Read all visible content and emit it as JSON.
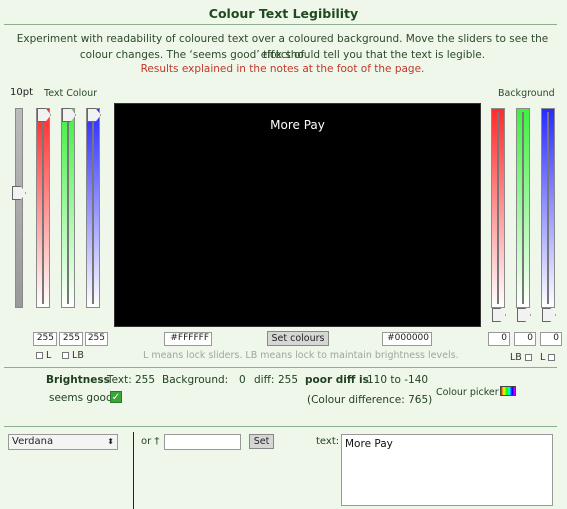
{
  "title": "Colour Text Legibility",
  "intro": {
    "line1": "Experiment with readability of coloured text over a coloured background. Move the sliders to see the effect of",
    "line2": "colour changes. The ‘seems good’ tick should tell you that the text is legible.",
    "notes": "Results explained in the notes at the foot of the page."
  },
  "size_label": "10pt",
  "text_colour": {
    "label": "Text Colour",
    "r": "255",
    "g": "255",
    "b": "255",
    "hex": "#FFFFFF",
    "lock_l": "L",
    "lock_lb": "LB"
  },
  "background": {
    "label": "Background",
    "r": "0",
    "g": "0",
    "b": "0",
    "hex": "#000000",
    "lock_lb": "LB",
    "lock_l": "L"
  },
  "preview": {
    "text": "More Pay",
    "bg_color": "#000000",
    "fg_color": "#FFFFFF"
  },
  "set_colours_label": "Set colours",
  "lock_note": "L means lock sliders. LB means lock to maintain brightness levels.",
  "stats": {
    "brightness_label": "Brightness",
    "text_label": "Text:",
    "text_value": "255",
    "bg_label": "Background:",
    "bg_value": "0",
    "diff_label": "diff:",
    "diff_value": "255",
    "poor_label": "poor diff is",
    "poor_range": "110 to -140",
    "seems_good": "seems good",
    "colour_diff": "(Colour difference: 765)",
    "colour_picker": "Colour picker"
  },
  "font": {
    "selected": "Verdana",
    "or_label": "or †",
    "custom_value": "",
    "set_label": "Set",
    "text_label": "text:",
    "textarea_value": "More Pay"
  }
}
